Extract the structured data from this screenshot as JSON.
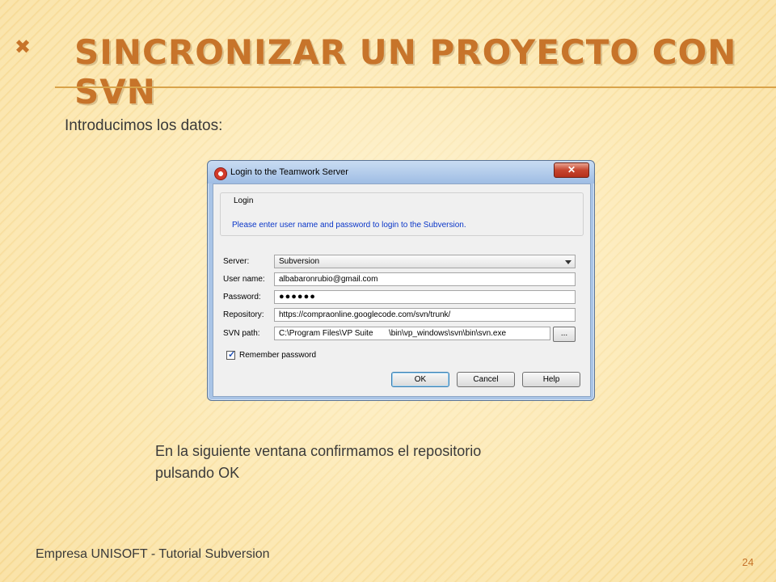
{
  "slide": {
    "title": "SINCRONIZAR UN PROYECTO CON SVN",
    "bullet_glyph": "✖",
    "intro": "Introducimos los datos:",
    "caption_line1": "En la siguiente ventana confirmamos el repositorio",
    "caption_line2": "pulsando OK",
    "footer": "Empresa UNISOFT -  Tutorial Subversion",
    "page_number": "24",
    "colors": {
      "title": "#c7742a",
      "background": "#f8dd9c",
      "link_text": "#0a36c8"
    }
  },
  "dialog": {
    "title": "Login to the Teamwork Server",
    "close_label": "✕",
    "group_label": "Login",
    "group_message": "Please enter user name and password to login to the Subversion.",
    "fields": {
      "server_label": "Server:",
      "server_value": "Subversion",
      "username_label": "User name:",
      "username_value": "albabaronrubio@gmail.com",
      "password_label": "Password:",
      "password_value": "●●●●●●",
      "repository_label": "Repository:",
      "repository_value": "https://compraonline.googlecode.com/svn/trunk/",
      "svnpath_label": "SVN path:",
      "svnpath_value": "C:\\Program Files\\VP Suite       \\bin\\vp_windows\\svn\\bin\\svn.exe",
      "browse_label": "..."
    },
    "remember_label": "Remember password",
    "remember_checked": true,
    "buttons": {
      "ok": "OK",
      "cancel": "Cancel",
      "help": "Help"
    }
  }
}
